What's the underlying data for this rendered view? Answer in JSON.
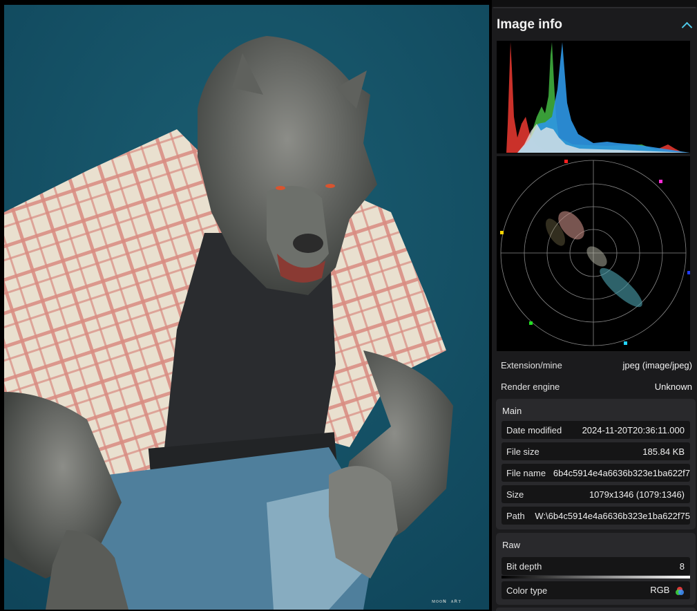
{
  "panel": {
    "title": "Image info",
    "collapse_icon": "chevron-up-icon",
    "accent": "#4fc9e8"
  },
  "summary": {
    "extension_label": "Extension/mine",
    "extension_value": "jpeg (image/jpeg)",
    "engine_label": "Render engine",
    "engine_value": "Unknown"
  },
  "main": {
    "title": "Main",
    "fields": [
      {
        "label": "Date modified",
        "value": "2024-11-20T20:36:11.000"
      },
      {
        "label": "File size",
        "value": "185.84 KB"
      },
      {
        "label": "File name",
        "value": "6b4c5914e4a6636b323e1ba622f7"
      },
      {
        "label": "Size",
        "value": "1079x1346 (1079:1346)"
      },
      {
        "label": "Path",
        "value": "W:\\6b4c5914e4a6636b323e1ba622f75"
      }
    ]
  },
  "raw": {
    "title": "Raw",
    "fields": [
      {
        "label": "Bit depth",
        "value": "8"
      },
      {
        "label": "Color type",
        "value": "RGB",
        "icon": "rgb-color-icon"
      }
    ]
  },
  "viewer": {
    "background": "#145063",
    "signature_icon": "artist-signature"
  }
}
